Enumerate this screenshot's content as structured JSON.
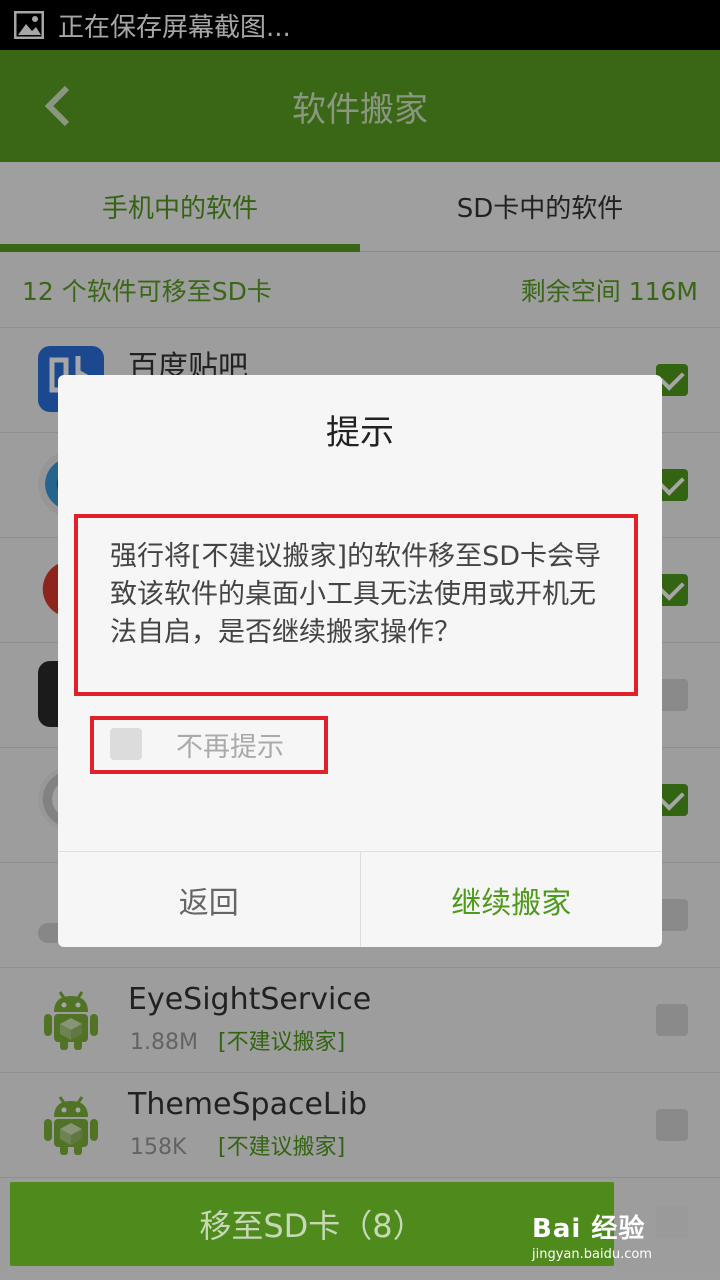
{
  "status_bar": {
    "text": "正在保存屏幕截图..."
  },
  "header": {
    "title": "软件搬家"
  },
  "tabs": [
    {
      "label": "手机中的软件"
    },
    {
      "label": "SD卡中的软件"
    }
  ],
  "summary": {
    "count_text": "12 个软件可移至SD卡",
    "space_text": "剩余空间 116M"
  },
  "apps": [
    {
      "name": "百度贴吧",
      "size": "",
      "tag": "",
      "checked": true,
      "icon": "tieba-icon",
      "icon_color": "#2a6fdb"
    },
    {
      "name": "",
      "size": "",
      "tag": "",
      "checked": true,
      "icon": "camera-icon",
      "icon_color": "#3a9ad9"
    },
    {
      "name": "",
      "size": "",
      "tag": "",
      "checked": true,
      "icon": "weibo-icon",
      "icon_color": "#d93a2b"
    },
    {
      "name": "",
      "size": "",
      "tag": "",
      "checked": false,
      "icon": "app-icon",
      "icon_color": "#2a2a2a"
    },
    {
      "name": "",
      "size": "",
      "tag": "",
      "checked": true,
      "icon": "clock-icon",
      "icon_color": "#dddddd"
    },
    {
      "name": "",
      "size": "",
      "tag": "",
      "checked": false,
      "icon": "app-icon",
      "icon_color": "#bbbbbb"
    },
    {
      "name": "EyeSightService",
      "size": "1.88M",
      "tag": "[不建议搬家]",
      "checked": false,
      "icon": "android-icon",
      "icon_color": "#7bb13a"
    },
    {
      "name": "ThemeSpaceLib",
      "size": "158K",
      "tag": "[不建议搬家]",
      "checked": false,
      "icon": "android-icon",
      "icon_color": "#7bb13a"
    }
  ],
  "bottom": {
    "move_label": "移至SD卡（8）"
  },
  "watermark": {
    "main": "Bai 经验",
    "sub": "jingyan.baidu.com"
  },
  "dialog": {
    "title": "提示",
    "message": "强行将[不建议搬家]的软件移至SD卡会导致该软件的桌面小工具无法使用或开机无法自启，是否继续搬家操作？",
    "dont_remind_label": "不再提示",
    "back_label": "返回",
    "continue_label": "继续搬家"
  },
  "colors": {
    "brand_green": "#5a9e22",
    "highlight_red": "#e0202a"
  }
}
